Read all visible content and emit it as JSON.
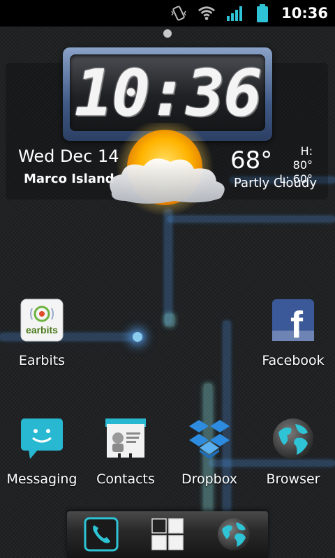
{
  "status_bar": {
    "time": "10:36",
    "icons": [
      "vibrate-icon",
      "wifi-icon",
      "signal-icon",
      "battery-icon"
    ]
  },
  "clock_widget": {
    "time": "10:36",
    "date": "Wed Dec 14",
    "location": "Marco Island",
    "temperature": "68°",
    "high": "H: 80°",
    "low": "L: 60°",
    "condition": "Partly Cloudy",
    "weather_icon": "partly-cloudy-icon"
  },
  "apps": {
    "earbits": {
      "label": "Earbits"
    },
    "facebook": {
      "label": "Facebook"
    },
    "messaging": {
      "label": "Messaging"
    },
    "contacts": {
      "label": "Contacts"
    },
    "dropbox": {
      "label": "Dropbox"
    },
    "browser": {
      "label": "Browser"
    }
  },
  "icon_text": {
    "earbits": "earbits",
    "facebook": "f"
  },
  "dock": {
    "items": [
      "phone-icon",
      "app-drawer-icon",
      "browser-icon"
    ]
  },
  "colors": {
    "accent_blue": "#3b8fe0",
    "teal": "#2ec4d6",
    "facebook_blue": "#3b5998"
  }
}
